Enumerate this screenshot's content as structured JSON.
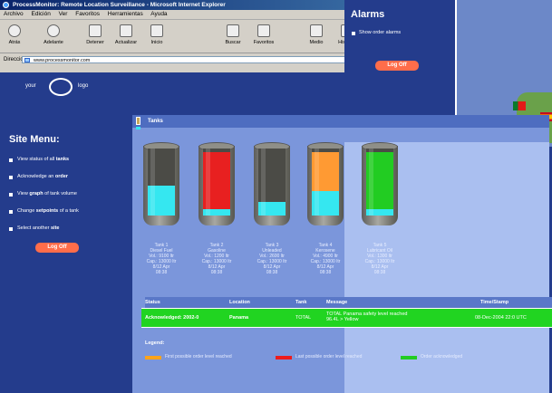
{
  "browser": {
    "title": "ProcessMonitor: Remote Location Surveillance - Microsoft Internet Explorer",
    "menu": [
      "Archivo",
      "Edición",
      "Ver",
      "Favoritos",
      "Herramientas",
      "Ayuda"
    ],
    "toolbar": [
      "Atrás",
      "Adelante",
      "Detener",
      "Actualizar",
      "Inicio",
      "Buscar",
      "Favoritos",
      "Medio",
      "Historial"
    ],
    "address_label": "Dirección",
    "address_value": "www.processmonitor.com"
  },
  "site": {
    "logo_left": "your",
    "logo_right": "logo",
    "menu_title": "Site Menu:",
    "menu": [
      {
        "pre": "View status of all ",
        "bold": "tanks",
        "post": ""
      },
      {
        "pre": "Acknowledge an ",
        "bold": "order",
        "post": ""
      },
      {
        "pre": "View ",
        "bold": "graph",
        "post": " of tank volume"
      },
      {
        "pre": "Change ",
        "bold": "setpoints",
        "post": " of a tank"
      },
      {
        "pre": "Select another ",
        "bold": "site",
        "post": ""
      }
    ],
    "logoff": "Log Off"
  },
  "alarms": {
    "title": "Alarms",
    "option": "Show order alarms",
    "logoff": "Log Off"
  },
  "tanks_window": {
    "title": "Tanks",
    "tanks": [
      {
        "name": "Tank 1",
        "product": "Diesel Fuel",
        "level_fraction": 0.44,
        "fill_color": "#35e7f0",
        "l1": "Vol.: 9100 ltr",
        "l2": "Cap.: 13000 ltr",
        "l3": "8/12 Apr",
        "l4": "08:38"
      },
      {
        "name": "Tank 2",
        "product": "Gasoline",
        "level_fraction": 0.1,
        "fill_color": "#35e7f0",
        "overlay_color": "#e82020",
        "l1": "Vol.: 1200 ltr",
        "l2": "Cap.: 13000 ltr",
        "l3": "8/12 Apr",
        "l4": "08:38"
      },
      {
        "name": "Tank 3",
        "product": "Unleaded",
        "level_fraction": 0.2,
        "fill_color": "#35e7f0",
        "l1": "Vol.: 2600 ltr",
        "l2": "Cap.: 13000 ltr",
        "l3": "8/12 Apr",
        "l4": "08:38"
      },
      {
        "name": "Tank 4",
        "product": "Kerosene",
        "level_fraction": 0.37,
        "fill_color": "#35e7f0",
        "overlay_color": "#ff9a33",
        "l1": "Vol.: 4900 ltr",
        "l2": "Cap.: 13000 ltr",
        "l3": "8/12 Apr",
        "l4": "08:38"
      },
      {
        "name": "Tank 5",
        "product": "Lubricant Oil",
        "level_fraction": 0.1,
        "fill_color": "#35e7f0",
        "overlay_color": "#22cc22",
        "l1": "Vol.: 1300 ltr",
        "l2": "Cap.: 13000 ltr",
        "l3": "8/12 Apr",
        "l4": "08:38"
      }
    ],
    "table": {
      "headers": [
        "Status",
        "Location",
        "Tank",
        "Message",
        "Time/Stamp"
      ],
      "row": {
        "status": "Acknowledged: 2002-0",
        "location": "Panama",
        "tank": "TOTAL",
        "message": "TOTAL Panama safety level reached 96.4L > Yellow",
        "time": "08-Dec-2004 22:0 UTC"
      }
    },
    "legend": {
      "title": "Legend:",
      "items": [
        {
          "color": "#ffa31a",
          "text": "First possible order level reached"
        },
        {
          "color": "#ee1c1c",
          "text": "Last possible order level reached"
        },
        {
          "color": "#22cc22",
          "text": "Order acknowledged"
        }
      ]
    }
  }
}
